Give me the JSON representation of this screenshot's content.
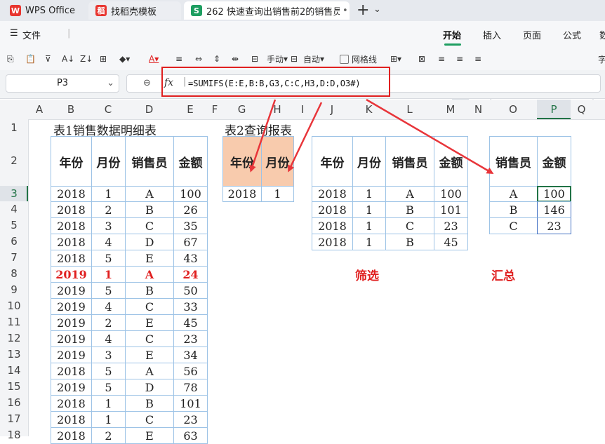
{
  "tabs": [
    {
      "label": "WPS Office",
      "icon": "wps-logo-icon",
      "color": "#e8352f"
    },
    {
      "label": "找稻壳模板",
      "icon": "docer-logo-icon",
      "color": "#e8352f"
    },
    {
      "label": "262 快速查询出销售前2的销售员",
      "icon": "sheet-icon",
      "color": "#1e9e61",
      "close": "•"
    }
  ],
  "tab_add": "+",
  "tab_more": "⌄",
  "menu": {
    "file": "文件",
    "items": [
      "开始",
      "插入",
      "页面",
      "公式",
      "数"
    ]
  },
  "toolbar": {
    "font_size_label": "手动",
    "auto_label": "自动",
    "gridlines_label": "网格线",
    "font_name": "宋体",
    "font_more": "字"
  },
  "namebox": "P3",
  "fx": "fx",
  "formula": "=SUMIFS(E:E,B:B,G3,C:C,H3,D:D,O3#)",
  "columns": [
    "A",
    "B",
    "C",
    "D",
    "E",
    "F",
    "G",
    "H",
    "I",
    "J",
    "K",
    "L",
    "M",
    "N",
    "O",
    "P",
    "Q"
  ],
  "rows": [
    "1",
    "2",
    "3",
    "4",
    "5",
    "6",
    "7",
    "8",
    "9",
    "10",
    "11",
    "12",
    "13",
    "14",
    "15",
    "16",
    "17",
    "18"
  ],
  "table1": {
    "title": "表1销售数据明细表",
    "headers": [
      "年份",
      "月份",
      "销售员",
      "金额"
    ],
    "rows": [
      [
        "2018",
        "1",
        "A",
        "100"
      ],
      [
        "2018",
        "2",
        "B",
        "26"
      ],
      [
        "2018",
        "3",
        "C",
        "35"
      ],
      [
        "2018",
        "4",
        "D",
        "67"
      ],
      [
        "2018",
        "5",
        "E",
        "43"
      ],
      [
        "2019",
        "1",
        "A",
        "24"
      ],
      [
        "2019",
        "5",
        "B",
        "50"
      ],
      [
        "2019",
        "4",
        "C",
        "33"
      ],
      [
        "2019",
        "2",
        "E",
        "45"
      ],
      [
        "2019",
        "4",
        "C",
        "23"
      ],
      [
        "2019",
        "3",
        "E",
        "34"
      ],
      [
        "2018",
        "5",
        "A",
        "56"
      ],
      [
        "2019",
        "5",
        "D",
        "78"
      ],
      [
        "2018",
        "1",
        "B",
        "101"
      ],
      [
        "2018",
        "1",
        "C",
        "23"
      ],
      [
        "2018",
        "2",
        "E",
        "63"
      ]
    ],
    "highlight_row": 5,
    "highlight_color": "#e02020"
  },
  "table2": {
    "title": "表2查询报表",
    "headers": [
      "年份",
      "月份"
    ],
    "values": [
      "2018",
      "1"
    ],
    "header_bg": "#f8cbad"
  },
  "filter": {
    "headers": [
      "年份",
      "月份",
      "销售员",
      "金额"
    ],
    "rows": [
      [
        "2018",
        "1",
        "A",
        "100"
      ],
      [
        "2018",
        "1",
        "B",
        "101"
      ],
      [
        "2018",
        "1",
        "C",
        "23"
      ],
      [
        "2018",
        "1",
        "B",
        "45"
      ]
    ],
    "label": "筛选"
  },
  "summary": {
    "headers": [
      "销售员",
      "金额"
    ],
    "rows": [
      [
        "A",
        "100"
      ],
      [
        "B",
        "146"
      ],
      [
        "C",
        "23"
      ]
    ],
    "label": "汇总"
  },
  "colors": {
    "accent": "#1e9e61",
    "arrow": "#e8353a",
    "formula_box": "#e02020",
    "selected_cell": "#217346"
  }
}
